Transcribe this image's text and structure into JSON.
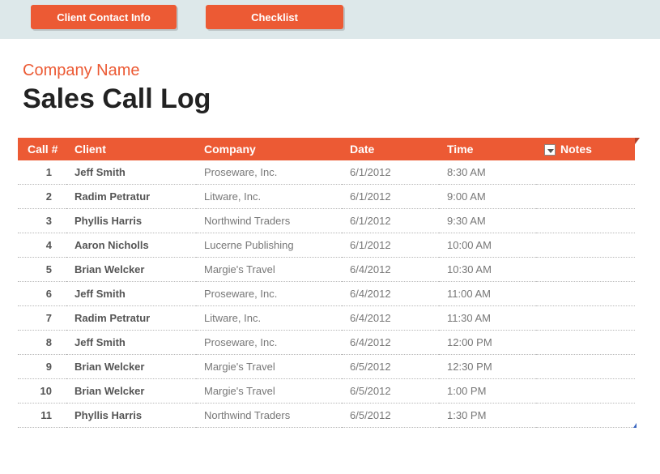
{
  "buttons": {
    "contact": "Client Contact Info",
    "checklist": "Checklist"
  },
  "header": {
    "company_label": "Company Name",
    "title": "Sales Call Log"
  },
  "columns": {
    "call": "Call #",
    "client": "Client",
    "company": "Company",
    "date": "Date",
    "time": "Time",
    "notes": "Notes"
  },
  "rows": [
    {
      "call": "1",
      "client": "Jeff Smith",
      "company": "Proseware, Inc.",
      "date": "6/1/2012",
      "time": "8:30 AM",
      "notes": ""
    },
    {
      "call": "2",
      "client": "Radim Petratur",
      "company": "Litware, Inc.",
      "date": "6/1/2012",
      "time": "9:00 AM",
      "notes": ""
    },
    {
      "call": "3",
      "client": "Phyllis Harris",
      "company": "Northwind Traders",
      "date": "6/1/2012",
      "time": "9:30 AM",
      "notes": ""
    },
    {
      "call": "4",
      "client": "Aaron Nicholls",
      "company": "Lucerne Publishing",
      "date": "6/1/2012",
      "time": "10:00 AM",
      "notes": ""
    },
    {
      "call": "5",
      "client": "Brian Welcker",
      "company": "Margie's Travel",
      "date": "6/4/2012",
      "time": "10:30 AM",
      "notes": ""
    },
    {
      "call": "6",
      "client": "Jeff Smith",
      "company": "Proseware, Inc.",
      "date": "6/4/2012",
      "time": "11:00 AM",
      "notes": ""
    },
    {
      "call": "7",
      "client": "Radim Petratur",
      "company": "Litware, Inc.",
      "date": "6/4/2012",
      "time": "11:30 AM",
      "notes": ""
    },
    {
      "call": "8",
      "client": "Jeff Smith",
      "company": "Proseware, Inc.",
      "date": "6/4/2012",
      "time": "12:00 PM",
      "notes": ""
    },
    {
      "call": "9",
      "client": "Brian Welcker",
      "company": "Margie's Travel",
      "date": "6/5/2012",
      "time": "12:30 PM",
      "notes": ""
    },
    {
      "call": "10",
      "client": "Brian Welcker",
      "company": "Margie's Travel",
      "date": "6/5/2012",
      "time": "1:00 PM",
      "notes": ""
    },
    {
      "call": "11",
      "client": "Phyllis Harris",
      "company": "Northwind Traders",
      "date": "6/5/2012",
      "time": "1:30 PM",
      "notes": ""
    }
  ]
}
